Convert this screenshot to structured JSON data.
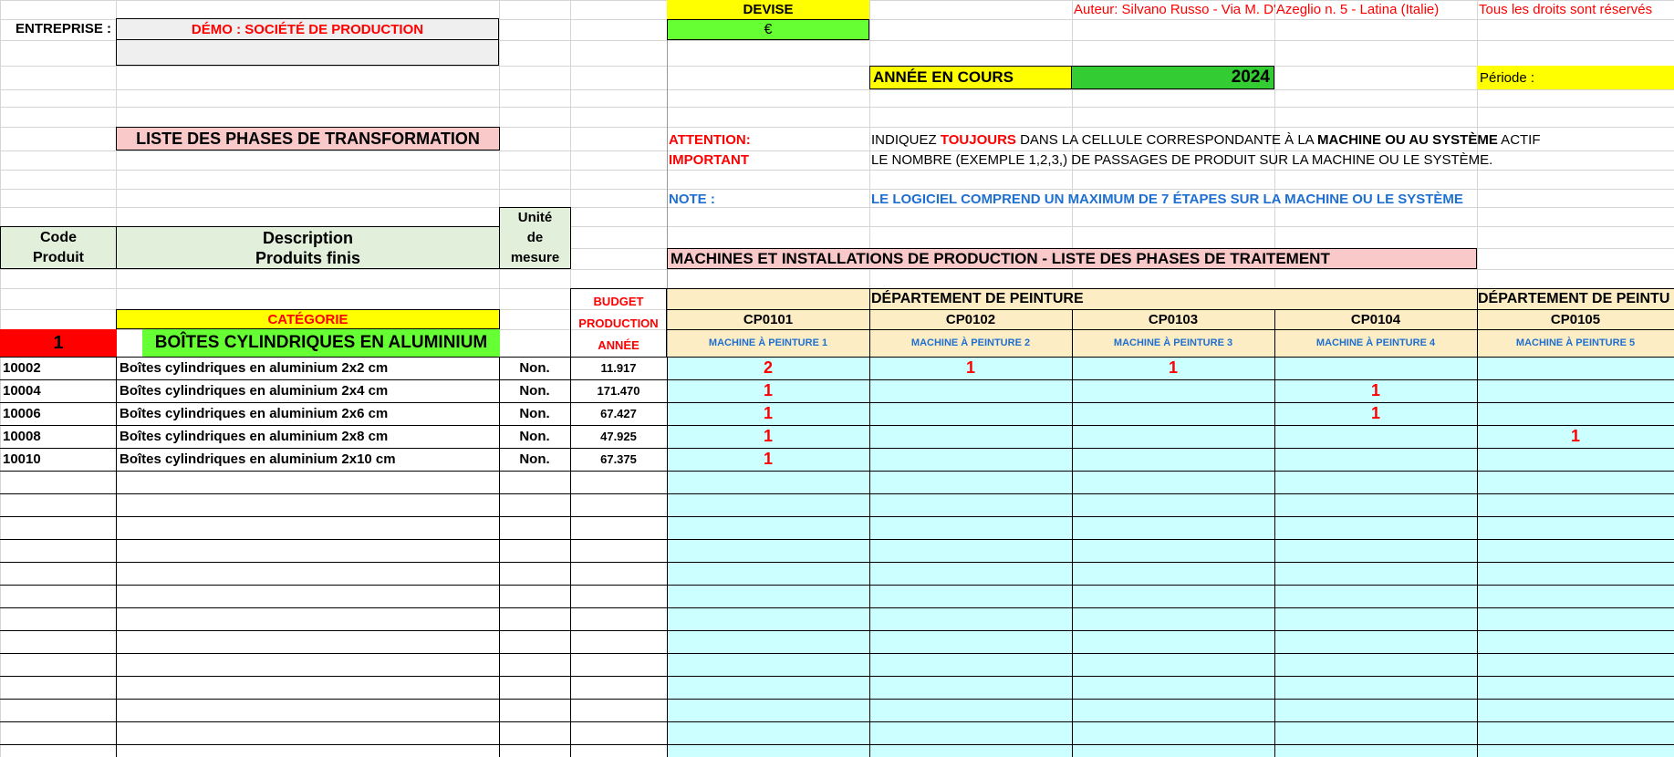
{
  "header": {
    "company_label": "ENTREPRISE :",
    "company_name": "DÉMO : SOCIÉTÉ DE PRODUCTION",
    "currency_label": "DEVISE",
    "currency_value": "€",
    "author": "Auteur: Silvano Russo - Via M. D'Azeglio n. 5 - Latina (Italie)",
    "rights": "Tous les droits sont réservés",
    "year_label": "ANNÉE EN COURS",
    "year_value": "2024",
    "period_label": "Période :"
  },
  "notes": {
    "list_title": "LISTE DES PHASES DE TRANSFORMATION",
    "attention_label": "ATTENTION:",
    "important_label": "IMPORTANT",
    "note_label": "NOTE :",
    "line1_a": "INDIQUEZ ",
    "line1_b": "TOUJOURS",
    "line1_c": " DANS LA CELLULE CORRESPONDANTE À LA ",
    "line1_d": "MACHINE OU AU SYSTÈME",
    "line1_e": " ACTIF",
    "line2": "LE NOMBRE (EXEMPLE 1,2,3,) DE PASSAGES DE PRODUIT SUR LA MACHINE OU LE SYSTÈME.",
    "note_text": "LE LOGICIEL COMPREND UN MAXIMUM DE 7 ÉTAPES SUR LA MACHINE OU LE SYSTÈME",
    "machines_title": "MACHINES ET INSTALLATIONS DE PRODUCTION - LISTE DES PHASES DE TRAITEMENT"
  },
  "columns": {
    "code_1": "Code",
    "code_2": "Produit",
    "desc_1": "Description",
    "desc_2": "Produits finis",
    "unit_1": "Unité",
    "unit_2": "de",
    "unit_3": "mesure",
    "budget_1": "BUDGET",
    "budget_2": "PRODUCTION",
    "budget_3": "ANNÉE"
  },
  "category": {
    "label": "CATÉGORIE",
    "number": "1",
    "name": "BOÎTES CYLINDRIQUES EN ALUMINIUM"
  },
  "departments": {
    "dept1": "DÉPARTEMENT DE PEINTURE",
    "dept2": "DÉPARTEMENT DE PEINTU"
  },
  "machines": [
    {
      "code": "CP0101",
      "name": "MACHINE À PEINTURE 1"
    },
    {
      "code": "CP0102",
      "name": "MACHINE À PEINTURE 2"
    },
    {
      "code": "CP0103",
      "name": "MACHINE À PEINTURE 3"
    },
    {
      "code": "CP0104",
      "name": "MACHINE À PEINTURE 4"
    },
    {
      "code": "CP0105",
      "name": "MACHINE À PEINTURE 5"
    }
  ],
  "products": [
    {
      "code": "10002",
      "desc": "Boîtes cylindriques en aluminium 2x2 cm",
      "unit": "Non.",
      "budget": "11.917",
      "m": [
        "2",
        "1",
        "1",
        "",
        ""
      ]
    },
    {
      "code": "10004",
      "desc": "Boîtes cylindriques en aluminium 2x4 cm",
      "unit": "Non.",
      "budget": "171.470",
      "m": [
        "1",
        "",
        "",
        "1",
        ""
      ]
    },
    {
      "code": "10006",
      "desc": "Boîtes cylindriques en aluminium 2x6 cm",
      "unit": "Non.",
      "budget": "67.427",
      "m": [
        "1",
        "",
        "",
        "1",
        ""
      ]
    },
    {
      "code": "10008",
      "desc": "Boîtes cylindriques en aluminium 2x8 cm",
      "unit": "Non.",
      "budget": "47.925",
      "m": [
        "1",
        "",
        "",
        "",
        "1"
      ]
    },
    {
      "code": "10010",
      "desc": "Boîtes cylindriques en aluminium 2x10 cm",
      "unit": "Non.",
      "budget": "67.375",
      "m": [
        "1",
        "",
        "",
        "",
        ""
      ]
    }
  ],
  "colors": {
    "yellow": "#ffff00",
    "green": "#66ff33",
    "pink": "#f9c8c8",
    "light_green": "#e2efda",
    "cream": "#fdedc4",
    "cyan": "#ccffff",
    "red": "#ff0000",
    "blue": "#1f6fd1"
  }
}
